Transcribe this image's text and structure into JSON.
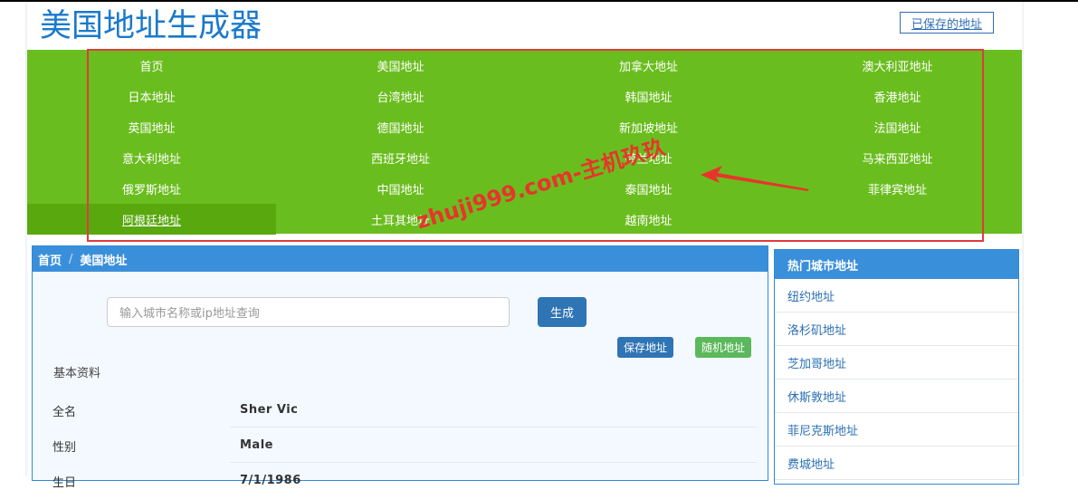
{
  "header": {
    "logo": "美国地址生成器",
    "saved_label": "已保存的地址"
  },
  "nav": {
    "items": [
      "首页",
      "美国地址",
      "加拿大地址",
      "澳大利亚地址",
      "日本地址",
      "台湾地址",
      "韩国地址",
      "香港地址",
      "英国地址",
      "德国地址",
      "新加坡地址",
      "法国地址",
      "意大利地址",
      "西班牙地址",
      "荷兰地址",
      "马来西亚地址",
      "俄罗斯地址",
      "中国地址",
      "泰国地址",
      "菲律宾地址",
      "阿根廷地址",
      "土耳其地址",
      "越南地址"
    ],
    "active_index": 20
  },
  "watermark": "zhuji999.com-主机玖玖",
  "breadcrumb": {
    "home": "首页",
    "sep": "/",
    "current": "美国地址"
  },
  "search": {
    "placeholder": "输入城市名称或ip地址查询",
    "generate_label": "生成"
  },
  "actions": {
    "save_label": "保存地址",
    "random_label": "随机地址"
  },
  "profile": {
    "section_title": "基本资料",
    "rows": [
      {
        "label": "全名",
        "value": "Sher Vic"
      },
      {
        "label": "性别",
        "value": "Male"
      },
      {
        "label": "生日",
        "value": "7/1/1986"
      }
    ]
  },
  "sidebar": {
    "title": "热门城市地址",
    "items": [
      "纽约地址",
      "洛杉矶地址",
      "芝加哥地址",
      "休斯敦地址",
      "菲尼克斯地址",
      "费城地址"
    ]
  },
  "colors": {
    "nav_green": "#6abd1e",
    "primary_blue": "#3a8fdb",
    "annotation_red": "#e03c3c"
  }
}
